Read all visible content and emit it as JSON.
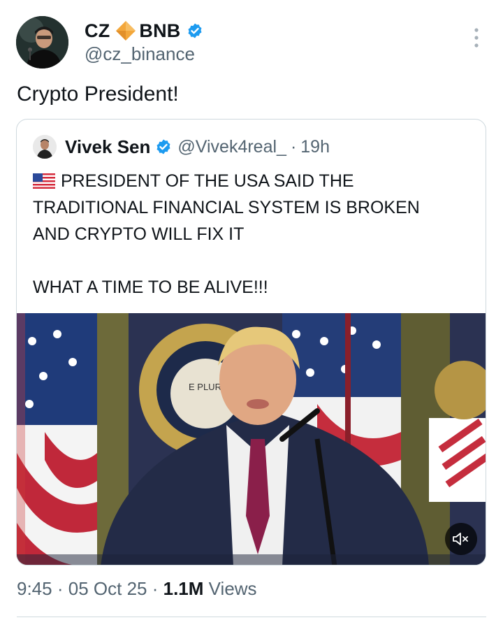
{
  "tweet": {
    "author": {
      "name_prefix": "CZ",
      "name_suffix": "BNB",
      "handle": "@cz_binance",
      "diamond_icon": "bnb-diamond-icon",
      "diamond_color": "#f3a73b",
      "verified_color": "#1d9bf0"
    },
    "text": "Crypto President!",
    "meta": {
      "time": "9:45",
      "date": "05 Oct 25",
      "separator": "·",
      "views_count": "1.1M",
      "views_label": "Views"
    }
  },
  "quote": {
    "author_name": "Vivek Sen",
    "handle": "@Vivek4real_",
    "separator": "·",
    "time": "19h",
    "flag_icon": "us-flag-icon",
    "lines": [
      "PRESIDENT OF THE USA SAID THE",
      "TRADITIONAL FINANCIAL SYSTEM IS BROKEN",
      "AND CRYPTO WILL FIX IT",
      "WHAT A TIME TO BE ALIVE!!!"
    ],
    "media": {
      "seal_text": "E PLUR",
      "mute_icon": "volume-muted-icon"
    }
  }
}
